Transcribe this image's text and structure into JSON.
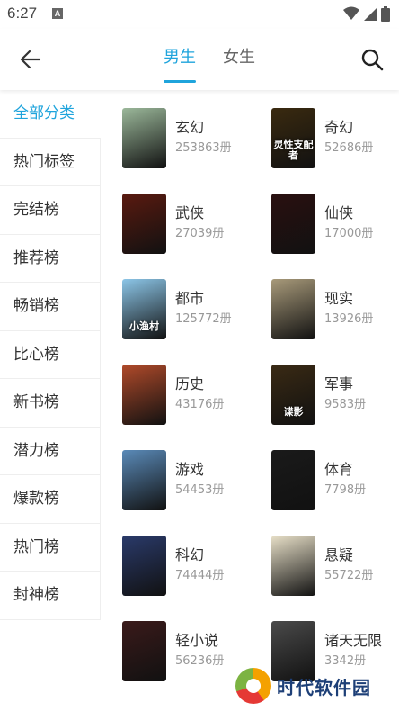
{
  "status": {
    "time": "6:27",
    "notif": "A"
  },
  "header": {
    "tabs": [
      {
        "label": "男生",
        "active": true
      },
      {
        "label": "女生",
        "active": false
      }
    ]
  },
  "sidebar": {
    "items": [
      {
        "label": "全部分类",
        "active": true
      },
      {
        "label": "热门标签"
      },
      {
        "label": "完结榜"
      },
      {
        "label": "推荐榜"
      },
      {
        "label": "畅销榜"
      },
      {
        "label": "比心榜"
      },
      {
        "label": "新书榜"
      },
      {
        "label": "潜力榜"
      },
      {
        "label": "爆款榜"
      },
      {
        "label": "热门榜"
      },
      {
        "label": "封神榜"
      }
    ]
  },
  "categories": [
    {
      "name": "玄幻",
      "count": "253863册",
      "cover_color": "#9bb89a",
      "cover_text": ""
    },
    {
      "name": "奇幻",
      "count": "52686册",
      "cover_color": "#3a2a10",
      "cover_text": "灵性支配者"
    },
    {
      "name": "武侠",
      "count": "27039册",
      "cover_color": "#5a1a10",
      "cover_text": ""
    },
    {
      "name": "仙侠",
      "count": "17000册",
      "cover_color": "#2a1010",
      "cover_text": ""
    },
    {
      "name": "都市",
      "count": "125772册",
      "cover_color": "#8cc6e8",
      "cover_text": "小渔村"
    },
    {
      "name": "现实",
      "count": "13926册",
      "cover_color": "#a89a7a",
      "cover_text": ""
    },
    {
      "name": "历史",
      "count": "43176册",
      "cover_color": "#b04a2a",
      "cover_text": ""
    },
    {
      "name": "军事",
      "count": "9583册",
      "cover_color": "#3a2a14",
      "cover_text": "谍影"
    },
    {
      "name": "游戏",
      "count": "54453册",
      "cover_color": "#5a8ab8",
      "cover_text": ""
    },
    {
      "name": "体育",
      "count": "7798册",
      "cover_color": "#1a1a1a",
      "cover_text": ""
    },
    {
      "name": "科幻",
      "count": "74444册",
      "cover_color": "#2a3a6a",
      "cover_text": ""
    },
    {
      "name": "悬疑",
      "count": "55722册",
      "cover_color": "#e8e0c8",
      "cover_text": ""
    },
    {
      "name": "轻小说",
      "count": "56236册",
      "cover_color": "#3a1a1a",
      "cover_text": ""
    },
    {
      "name": "诸天无限",
      "count": "3342册",
      "cover_color": "#4a4a4a",
      "cover_text": ""
    }
  ],
  "watermark": {
    "text": "时代软件园"
  },
  "colors": {
    "accent": "#1fa4dc"
  }
}
